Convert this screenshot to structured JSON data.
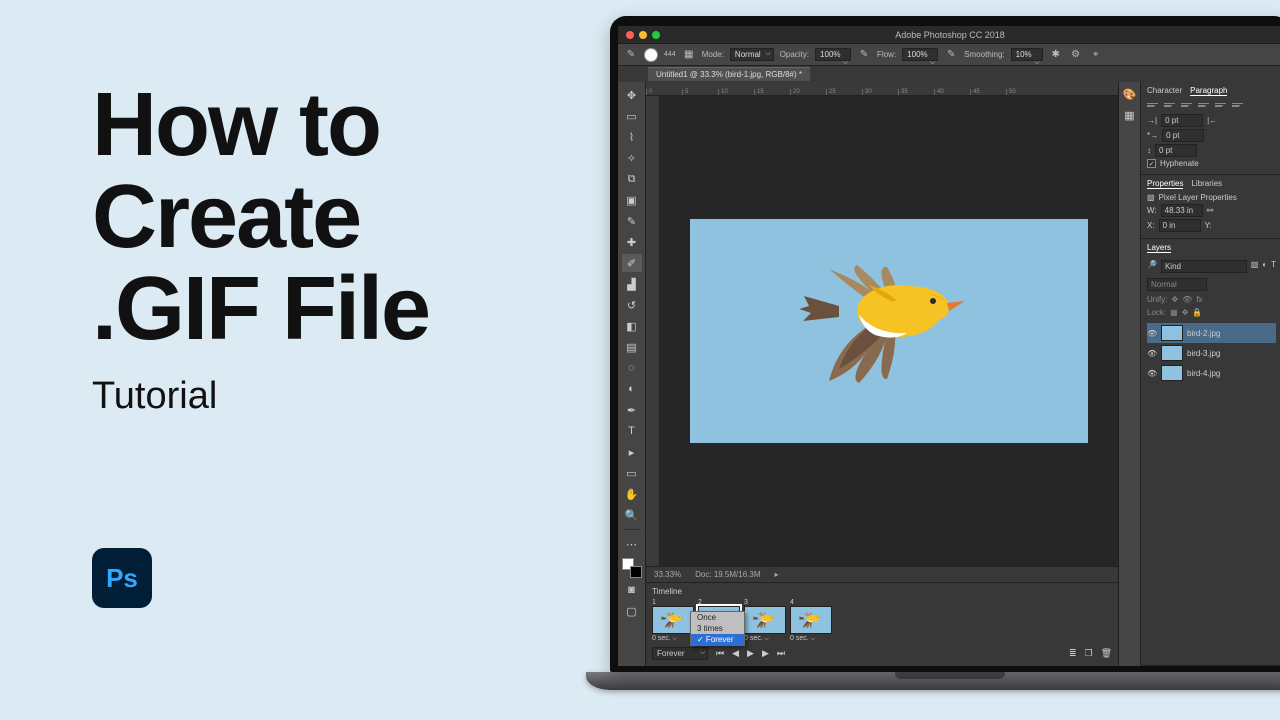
{
  "hero": {
    "line1": "How to",
    "line2": "Create",
    "line3": ".GIF File",
    "subtitle": "Tutorial",
    "ps_label": "Ps"
  },
  "app": {
    "title": "Adobe Photoshop CC 2018",
    "document_tab": "Untitled1 @ 33.3% (bird-1.jpg, RGB/8#) *",
    "options_bar": {
      "brush_size": "444",
      "mode_label": "Mode:",
      "mode_value": "Normal",
      "opacity_label": "Opacity:",
      "opacity_value": "100%",
      "flow_label": "Flow:",
      "flow_value": "100%",
      "smoothing_label": "Smoothing:",
      "smoothing_value": "10%"
    },
    "ruler_marks": [
      "0",
      "5",
      "10",
      "15",
      "20",
      "25",
      "30",
      "35",
      "40",
      "45",
      "50"
    ],
    "status": {
      "zoom": "33.33%",
      "doc": "Doc: 19.5M/16.3M"
    },
    "timeline": {
      "title": "Timeline",
      "frames": [
        {
          "n": "1",
          "dur": "0 sec."
        },
        {
          "n": "2",
          "dur": ""
        },
        {
          "n": "3",
          "dur": "0 sec."
        },
        {
          "n": "4",
          "dur": "0 sec."
        }
      ],
      "selected_index": 1,
      "loop_options": [
        "Once",
        "3 times",
        "Forever"
      ],
      "loop_selected": "Forever"
    },
    "right": {
      "char_tab": "Character",
      "para_tab": "Paragraph",
      "indent_values": [
        "0 pt",
        "0 pt",
        "0 pt"
      ],
      "hyphenate": "Hyphenate",
      "props_tab": "Properties",
      "libs_tab": "Libraries",
      "pixel_layer": "Pixel Layer Properties",
      "w_label": "W:",
      "w_value": "48.33 in",
      "x_label": "X:",
      "x_value": "0 in",
      "y_label": "Y:",
      "layers_tab": "Layers",
      "kind": "Kind",
      "blend": "Normal",
      "unify": "Unify:",
      "lock": "Lock:",
      "layer_items": [
        "bird-2.jpg",
        "bird-3.jpg",
        "bird-4.jpg"
      ]
    }
  }
}
